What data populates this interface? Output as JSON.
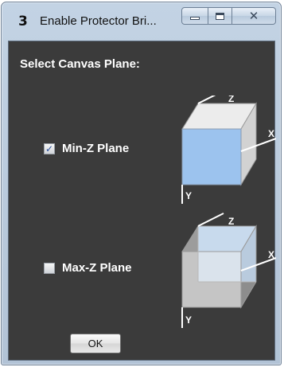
{
  "window": {
    "title": "Enable Protector Bri...",
    "app_icon_glyph": "3",
    "app_icon": "app-icon",
    "controls": {
      "minimize_icon": "minimize-icon",
      "maximize_icon": "maximize-icon",
      "close_glyph": "✕"
    }
  },
  "dialog": {
    "heading": "Select Canvas Plane:",
    "options": [
      {
        "label": "Min-Z Plane",
        "checked": true,
        "check_glyph": "✓",
        "highlighted_face": "front"
      },
      {
        "label": "Max-Z Plane",
        "checked": false,
        "check_glyph": "",
        "highlighted_face": "back"
      }
    ],
    "axes": {
      "x": "X",
      "y": "Y",
      "z": "Z"
    },
    "ok_label": "OK"
  },
  "colors": {
    "background": "#3b3b3b",
    "text": "#ffffff",
    "plane_highlight": "#9cc3ee",
    "cube_fill": "#e2e2e2",
    "titlebar": "#bfcfe0"
  }
}
